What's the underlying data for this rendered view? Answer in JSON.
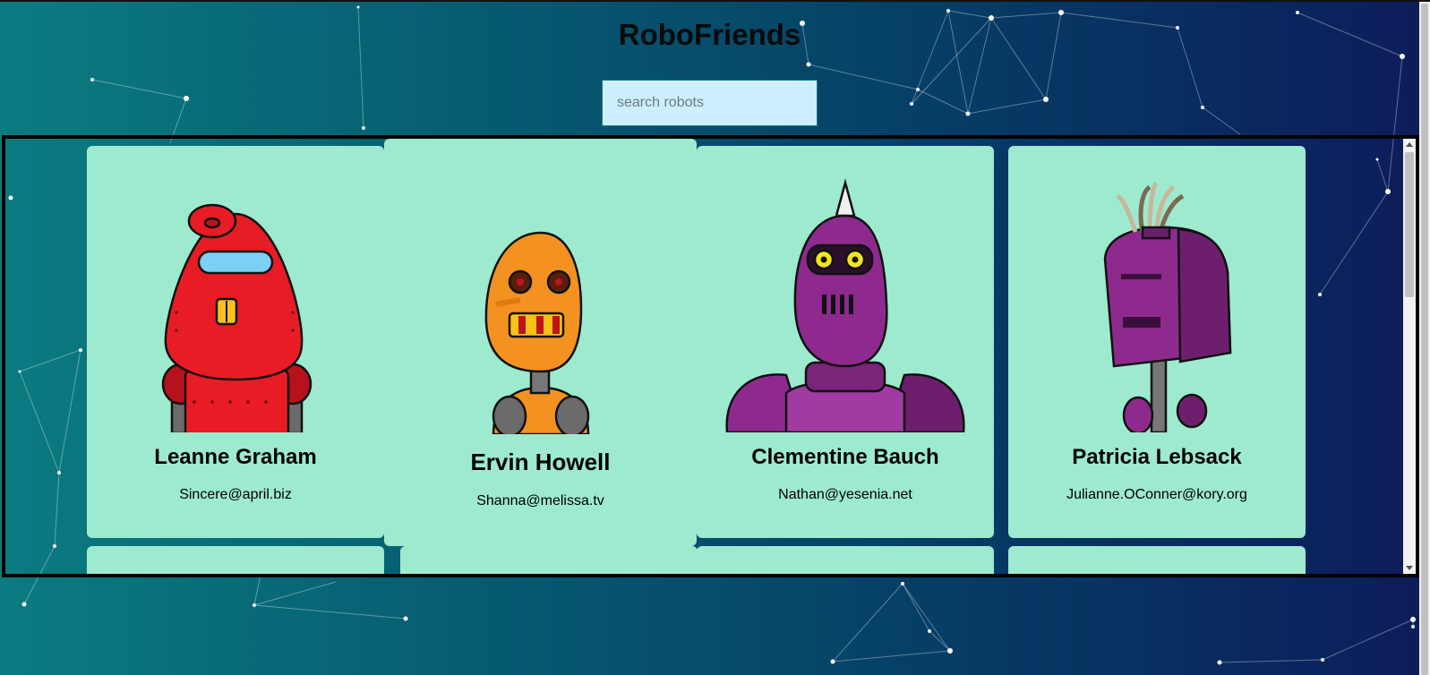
{
  "app": {
    "title": "RoboFriends",
    "search_placeholder": "search robots",
    "search_value": ""
  },
  "robots": [
    {
      "name": "Leanne Graham",
      "email": "Sincere@april.biz",
      "color": "#e81c25",
      "style": "red"
    },
    {
      "name": "Ervin Howell",
      "email": "Shanna@melissa.tv",
      "color": "#f39220",
      "style": "orange"
    },
    {
      "name": "Clementine Bauch",
      "email": "Nathan@yesenia.net",
      "color": "#8e2a8e",
      "style": "purple"
    },
    {
      "name": "Patricia Lebsack",
      "email": "Julianne.OConner@kory.org",
      "color": "#8e2a8e",
      "style": "purple-square"
    }
  ],
  "colors": {
    "card_background": "#9eeacf",
    "search_background": "#cdeefc",
    "background_start": "#0b7b80",
    "background_end": "#0c1c5a"
  }
}
